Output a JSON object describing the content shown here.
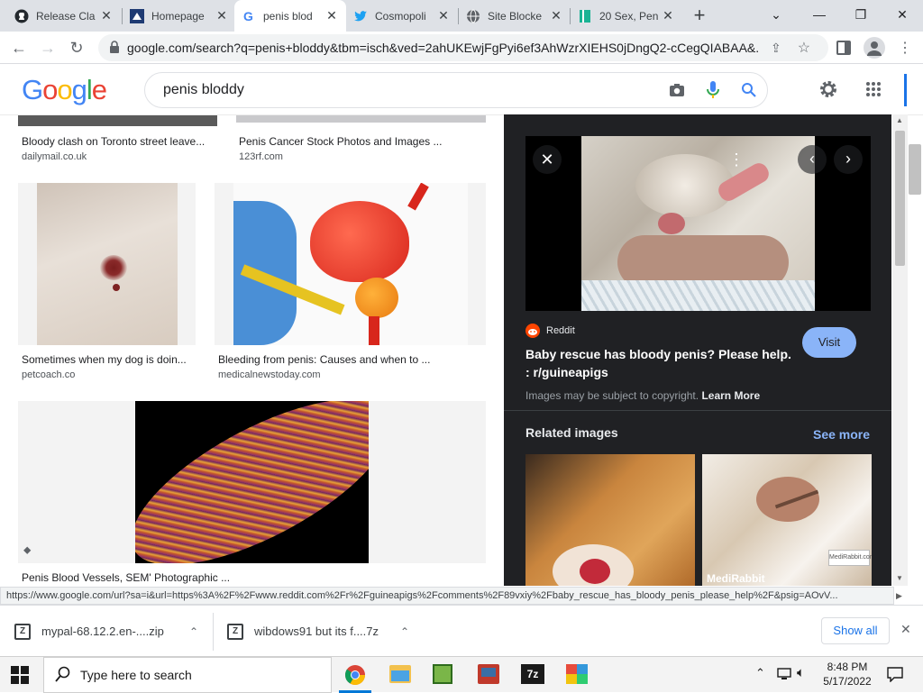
{
  "tabs": [
    {
      "title": "Release Cla",
      "favicon": "github-icon"
    },
    {
      "title": "Homepage",
      "favicon": "site-icon"
    },
    {
      "title": "penis blod",
      "favicon": "google-icon",
      "active": true
    },
    {
      "title": "Cosmopoli",
      "favicon": "twitter-icon"
    },
    {
      "title": "Site Blocke",
      "favicon": "globe-icon"
    },
    {
      "title": "20 Sex, Pen",
      "favicon": "bookmark-icon"
    }
  ],
  "address_bar": {
    "url": "google.com/search?q=penis+bloddy&tbm=isch&ved=2ahUKEwjFgPyi6ef3AhWzrXIEHS0jDngQ2-cCegQIABAA&..."
  },
  "google": {
    "logo": "Google",
    "query": "penis bloddy"
  },
  "results": [
    {
      "caption": "Bloody clash on Toronto street leave...",
      "source": "dailymail.co.uk"
    },
    {
      "caption": "Penis Cancer Stock Photos and Images ...",
      "source": "123rf.com"
    },
    {
      "caption": "Sometimes when my dog is doin...",
      "source": "petcoach.co"
    },
    {
      "caption": "Bleeding from penis: Causes and when to ...",
      "source": "medicalnewstoday.com"
    },
    {
      "caption": "Penis Blood Vessels, SEM' Photographic ...",
      "source": ""
    }
  ],
  "preview": {
    "site_name": "Reddit",
    "title_line1": "Baby rescue has bloody penis? Please help.",
    "title_line2": ": r/guineapigs",
    "visit_label": "Visit",
    "copyright": "Images may be subject to copyright.",
    "learn_more": "Learn More",
    "related_heading": "Related images",
    "see_more": "See more",
    "related_source": "MediRabbit",
    "related_watermark": "MediRabbit.com"
  },
  "status_url": "https://www.google.com/url?sa=i&url=https%3A%2F%2Fwww.reddit.com%2Fr%2Fguineapigs%2Fcomments%2F89vxiy%2Fbaby_rescue_has_bloody_penis_please_help%2F&psig=AOvV...",
  "downloads": [
    {
      "name": "mypal-68.12.2.en-....zip"
    },
    {
      "name": "wibdows91 but its f....7z"
    }
  ],
  "downloads_show_all": "Show all",
  "taskbar": {
    "search_placeholder": "Type here to search",
    "time": "8:48 PM",
    "date": "5/17/2022"
  },
  "colors": {
    "google_blue": "#4285F4",
    "google_red": "#EA4335",
    "google_yellow": "#FBBC05",
    "google_green": "#34A853",
    "panel_bg": "#202124",
    "link_blue": "#8ab4f8"
  }
}
